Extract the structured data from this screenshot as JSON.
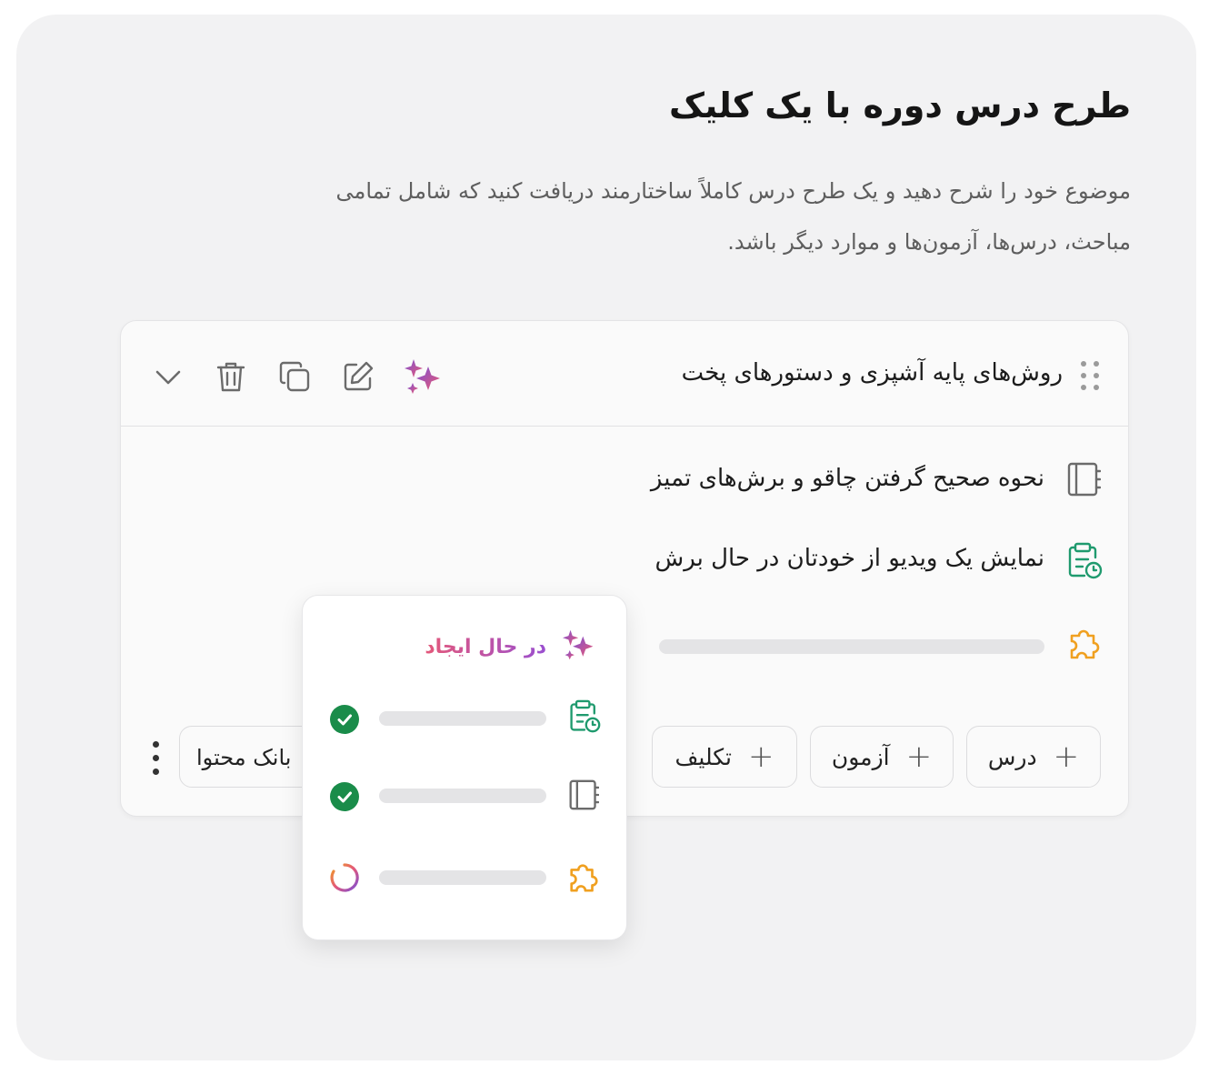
{
  "header": {
    "title": "طرح درس دوره با یک کلیک",
    "description": "موضوع خود را شرح دهید و یک طرح درس کاملاً ساختارمند دریافت کنید که شامل تمامی مباحث، درس‌ها، آزمون‌ها و موارد دیگر باشد."
  },
  "module": {
    "title": "روش‌های پایه آشپزی و دستورهای پخت",
    "toolbar_icons": [
      "sparkle-icon",
      "edit-icon",
      "copy-icon",
      "trash-icon",
      "chevron-down-icon"
    ],
    "items": [
      {
        "icon": "notebook-icon",
        "text": "نحوه صحیح گرفتن چاقو و برش‌های تمیز"
      },
      {
        "icon": "assignment-clock-icon",
        "text": "نمایش یک ویدیو از خودتان در حال برش"
      },
      {
        "icon": "puzzle-icon",
        "text": ""
      }
    ],
    "buttons": {
      "lesson": "درس",
      "quiz": "آزمون",
      "assignment": "تکلیف",
      "content_bank": "بانک محتوا"
    }
  },
  "popup": {
    "status": "در حال ایجاد",
    "items": [
      {
        "icon": "assignment-clock-icon",
        "state": "done"
      },
      {
        "icon": "notebook-icon",
        "state": "done"
      },
      {
        "icon": "puzzle-icon",
        "state": "loading"
      }
    ]
  },
  "colors": {
    "success": "#1a8c4a",
    "puzzle": "#f0a020",
    "assignment": "#1f9a6e",
    "gradient_start": "#e4587a",
    "gradient_end": "#9a4fd0"
  }
}
